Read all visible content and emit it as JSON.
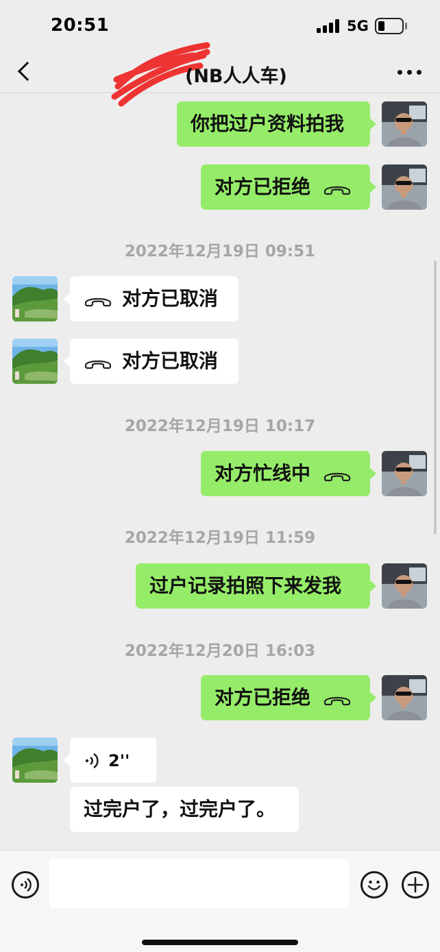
{
  "status_bar": {
    "time": "20:51",
    "network": "5G",
    "battery_level": 0.25
  },
  "nav": {
    "title_visible": "(NB人人车)"
  },
  "messages": [
    {
      "side": "out",
      "text": "你把过户资料拍我"
    },
    {
      "side": "out",
      "text": "对方已拒绝",
      "type": "call",
      "icon": "phone-hangup-icon"
    },
    {
      "timestamp": "2022年12月19日 09:51"
    },
    {
      "side": "in",
      "text": "对方已取消",
      "type": "call",
      "icon": "phone-hangup-icon"
    },
    {
      "side": "in",
      "text": "对方已取消",
      "type": "call",
      "icon": "phone-hangup-icon"
    },
    {
      "timestamp": "2022年12月19日 10:17"
    },
    {
      "side": "out",
      "text": "对方忙线中",
      "type": "call",
      "icon": "phone-hangup-icon"
    },
    {
      "timestamp": "2022年12月19日 11:59"
    },
    {
      "side": "out",
      "text": "过户记录拍照下来发我"
    },
    {
      "timestamp": "2022年12月20日 16:03"
    },
    {
      "side": "out",
      "text": "对方已拒绝",
      "type": "call",
      "icon": "phone-hangup-icon"
    },
    {
      "side": "in",
      "type": "voice",
      "duration": "2''",
      "icon": "voice-wave-icon"
    },
    {
      "side": "in",
      "text": "过完户了，过完户了。"
    }
  ],
  "input_bar": {
    "placeholder": ""
  },
  "colors": {
    "outgoing_bubble": "#95ec69",
    "incoming_bubble": "#ffffff",
    "background": "#ededed",
    "timestamp": "#a6a6a6"
  },
  "icons": [
    "back-chevron-icon",
    "more-dots-icon",
    "voice-input-icon",
    "emoji-icon",
    "plus-icon",
    "phone-hangup-icon",
    "voice-wave-icon"
  ]
}
